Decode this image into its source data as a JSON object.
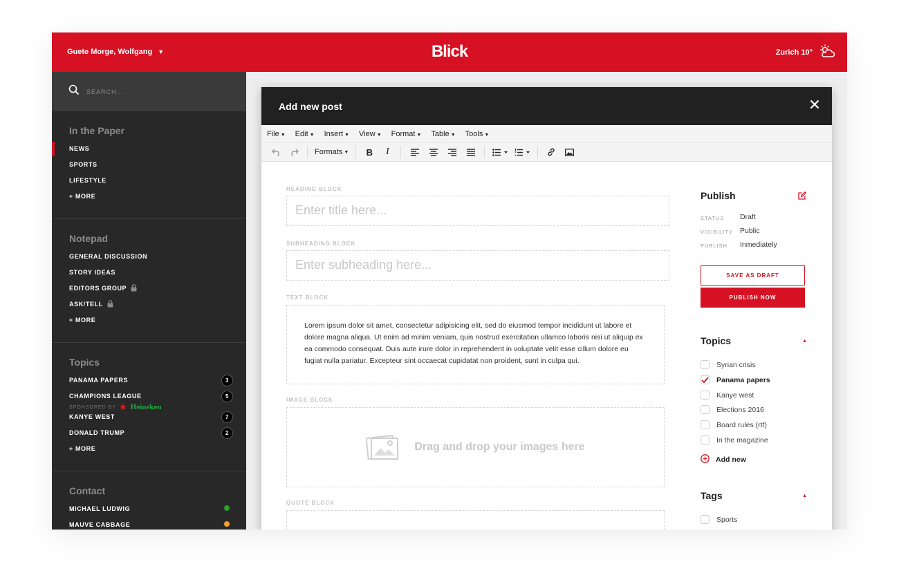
{
  "header": {
    "greeting": "Guete Morge, Wolfgang",
    "logo": "Blick",
    "weather": "Zurich 10°",
    "weather_icon": "partly-cloudy-icon",
    "brand_color": "#d51123"
  },
  "sidebar": {
    "search_placeholder": "SEARCH...",
    "paper": {
      "title": "In the Paper",
      "items": [
        {
          "label": "NEWS",
          "active": true
        },
        {
          "label": "SPORTS"
        },
        {
          "label": "LIFESTYLE"
        },
        {
          "label": "+ MORE"
        }
      ]
    },
    "notepad": {
      "title": "Notepad",
      "items": [
        {
          "label": "GENERAL DISCUSSION"
        },
        {
          "label": "STORY IDEAS"
        },
        {
          "label": "EDITORS GROUP",
          "locked": true
        },
        {
          "label": "ASK/TELL",
          "locked": true
        },
        {
          "label": "+ MORE"
        }
      ]
    },
    "topics": {
      "title": "Topics",
      "items": [
        {
          "label": "PANAMA PAPERS",
          "count": "3"
        },
        {
          "label": "CHAMPIONS LEAGUE",
          "count": "5",
          "sponsored_by": "SPONSORED BY",
          "sponsor": "Heineken"
        },
        {
          "label": "KANYE WEST",
          "count": "7"
        },
        {
          "label": "DONALD TRUMP",
          "count": "2"
        },
        {
          "label": "+ MORE"
        }
      ]
    },
    "contact": {
      "title": "Contact",
      "items": [
        {
          "label": "MICHAEL LUDWIG",
          "status_color": "#2fa12f"
        },
        {
          "label": "MAUVE CABBAGE",
          "status_color": "#f2a12a"
        }
      ]
    }
  },
  "modal": {
    "title": "Add new post",
    "menu": [
      "File",
      "Edit",
      "Insert",
      "View",
      "Format",
      "Table",
      "Tools"
    ],
    "toolbar": {
      "formats": "Formats",
      "icons": [
        "undo-icon",
        "redo-icon",
        "bold-icon",
        "italic-icon",
        "align-left-icon",
        "align-center-icon",
        "align-right-icon",
        "align-justify-icon",
        "bullet-list-icon",
        "numbered-list-icon",
        "link-icon",
        "image-icon"
      ]
    },
    "blocks": {
      "heading_label": "HEADING BLOCK",
      "heading_placeholder": "Enter title here...",
      "subheading_label": "SUBHEADING BLOCK",
      "subheading_placeholder": "Enter subheading here...",
      "text_label": "TEXT BLOCK",
      "text_body": "Lorem ipsum dolor sit amet, consectetur adipisicing elit, sed do eiusmod tempor incididunt ut labore et dolore magna aliqua. Ut enim ad minim veniam, quis nostrud exercitation ullamco laboris nisi ut aliquip ex ea commodo consequat. Duis aute irure dolor in reprehenderit in voluptate velit esse cillum dolore eu fugiat nulla pariatur. Excepteur sint occaecat cupidatat non proident, sunt in culpa qui.",
      "image_label": "IMAGE BLOCK",
      "image_drop": "Drag and drop your images here",
      "quote_label": "QUOTE BLOCK"
    },
    "publish": {
      "title": "Publish",
      "status_label": "STATUS",
      "status_value": "Draft",
      "visibility_label": "VISIBILITY",
      "visibility_value": "Public",
      "publish_label": "PUBLISH",
      "publish_value": "Inmediately",
      "save_draft": "SAVE AS DRAFT",
      "publish_now": "PUBLISH NOW"
    },
    "topics": {
      "title": "Topics",
      "items": [
        {
          "label": "Syrian crisis",
          "checked": false
        },
        {
          "label": "Panama papers",
          "checked": true
        },
        {
          "label": "Kanye west",
          "checked": false
        },
        {
          "label": "Elections 2016",
          "checked": false
        },
        {
          "label": "Board rules (rtf)",
          "checked": false
        },
        {
          "label": "In the magazine",
          "checked": false
        }
      ],
      "add_new": "Add new"
    },
    "tags": {
      "title": "Tags",
      "items": [
        {
          "label": "Sports",
          "checked": false
        }
      ]
    }
  }
}
